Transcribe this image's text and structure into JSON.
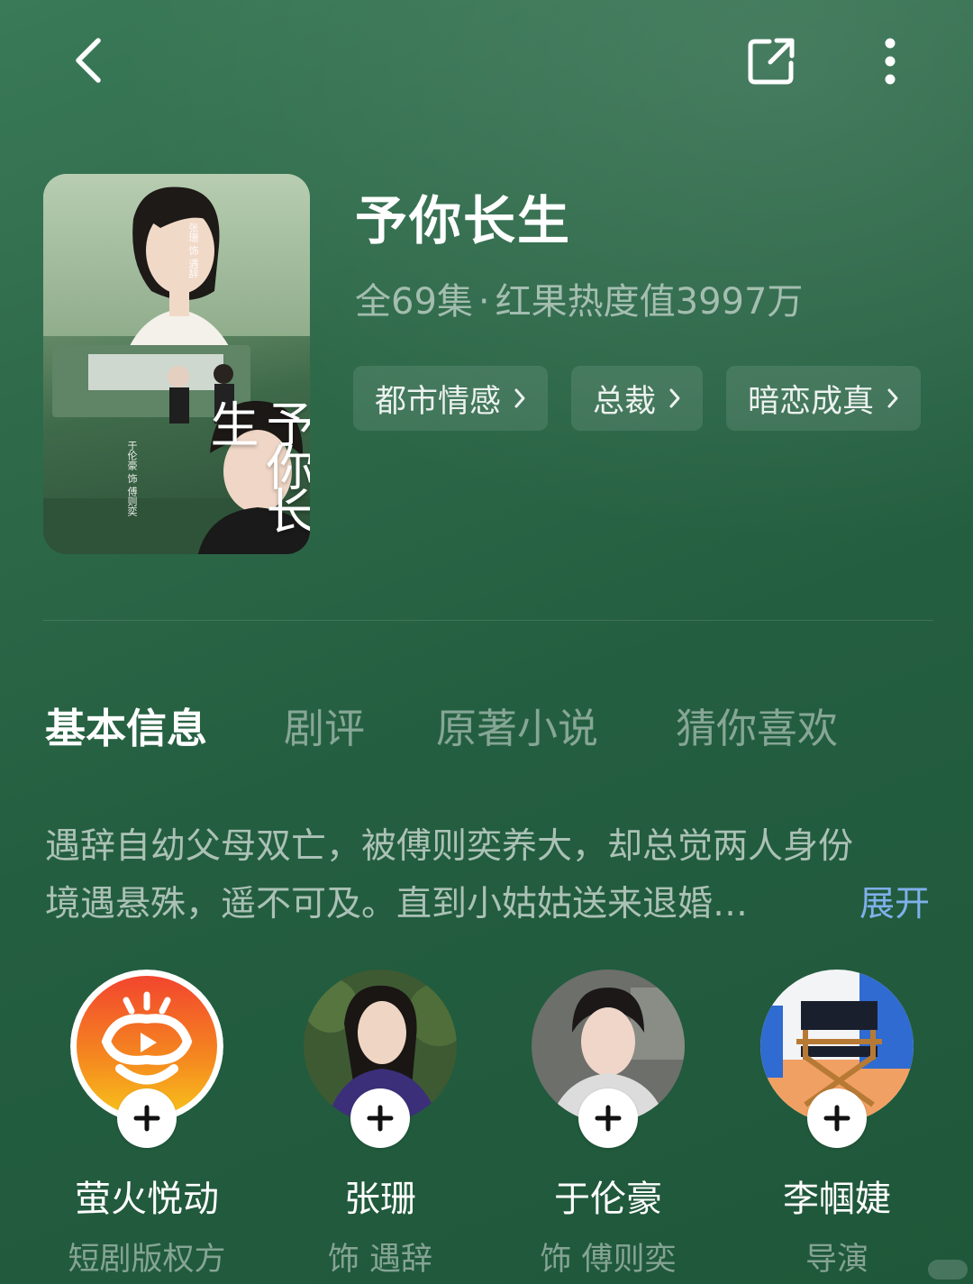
{
  "colors": {
    "background": "#2a6646",
    "accent_link": "#7fb0ea",
    "text_primary": "#ffffff",
    "text_secondary": "rgba(255,255,255,0.55)"
  },
  "header": {
    "back_icon": "chevron-left-icon",
    "share_icon": "share-icon",
    "more_icon": "more-vertical-icon"
  },
  "poster": {
    "title_text": "予你长生",
    "cast_top": "张珊 饰 遇辞",
    "cast_bottom": "于伦豪 饰 傅则奕",
    "gallery_icon": "gallery-icon"
  },
  "show": {
    "title": "予你长生",
    "episodes": "全69集",
    "separator": "·",
    "popularity": "红果热度值3997万",
    "tags": [
      {
        "label": "都市情感"
      },
      {
        "label": "总裁"
      },
      {
        "label": "暗恋成真"
      }
    ]
  },
  "tabs": [
    {
      "label": "基本信息",
      "active": true
    },
    {
      "label": "剧评",
      "active": false
    },
    {
      "label": "原著小说",
      "active": false
    },
    {
      "label": "猜你喜欢",
      "active": false
    }
  ],
  "synopsis": {
    "line1": "遇辞自幼父母双亡，被傅则奕养大，却总觉两人身份",
    "line2": "境遇悬殊，遥不可及。直到小姑姑送来退婚…",
    "expand_label": "展开"
  },
  "cast": [
    {
      "name": "萤火悦动",
      "role": "短剧版权方"
    },
    {
      "name": "张珊",
      "role": "饰 遇辞"
    },
    {
      "name": "于伦豪",
      "role": "饰 傅则奕"
    },
    {
      "name": "李帼婕",
      "role": "导演"
    }
  ]
}
